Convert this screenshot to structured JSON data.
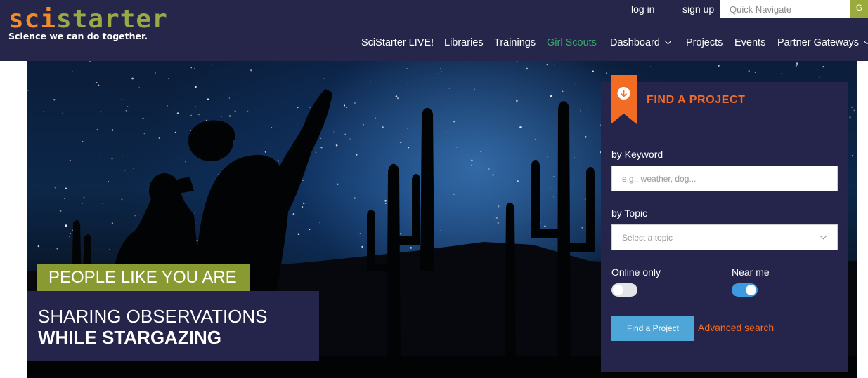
{
  "header": {
    "logo_sci": "sci",
    "logo_starter": "starter",
    "tagline": "Science we can do together.",
    "login_label": "log in",
    "signup_label": "sign up",
    "quick_navigate_placeholder": "Quick Navigate",
    "quick_navigate_button": "G",
    "nav": [
      {
        "label": "SciStarter LIVE!"
      },
      {
        "label": "Libraries"
      },
      {
        "label": "Trainings"
      },
      {
        "label": "Girl Scouts",
        "highlight_color": "#3aa76d"
      },
      {
        "label": "Dashboard",
        "has_dropdown": true
      },
      {
        "label": "Projects"
      },
      {
        "label": "Events"
      },
      {
        "label": "Partner Gateways",
        "has_dropdown": true
      }
    ]
  },
  "hero": {
    "line1": "PEOPLE LIKE YOU ARE",
    "line2": "SHARING OBSERVATIONS",
    "line3": "WHILE STARGAZING"
  },
  "find_project": {
    "title": "FIND A PROJECT",
    "icon": "arrow-down-circle-icon",
    "keyword_label": "by Keyword",
    "keyword_placeholder": "e.g., weather, dog...",
    "topic_label": "by Topic",
    "topic_selected": "Select a topic",
    "online_only_label": "Online only",
    "online_only_on": false,
    "near_me_label": "Near me",
    "near_me_on": true,
    "submit_label": "Find a Project",
    "advanced_label": "Advanced search"
  },
  "colors": {
    "header_bg": "#252649",
    "panel_bg": "#25244a",
    "accent_orange": "#f26c23",
    "accent_green": "#8a9a32",
    "button_blue": "#4ea6d8"
  }
}
